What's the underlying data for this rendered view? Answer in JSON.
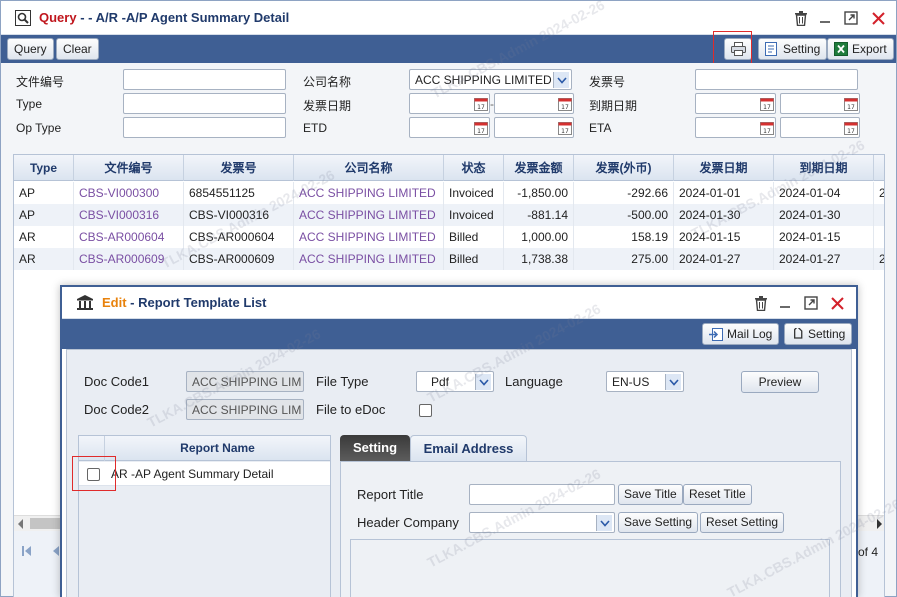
{
  "window": {
    "title_prefix": "Query",
    "title_rest": " - - A/R -A/P Agent Summary Detail"
  },
  "toolbar": {
    "query_label": "Query",
    "clear_label": "Clear",
    "setting_label": "Setting",
    "export_label": "Export"
  },
  "form": {
    "doc_no_label": "文件编号",
    "type_label": "Type",
    "op_type_label": "Op Type",
    "company_label": "公司名称",
    "company_value": "ACC SHIPPING LIMITED",
    "invoice_date_label": "发票日期",
    "etd_label": "ETD",
    "invoice_no_label": "发票号",
    "due_date_label": "到期日期",
    "eta_label": "ETA"
  },
  "grid": {
    "headers": [
      "Type",
      "文件编号",
      "发票号",
      "公司名称",
      "状态",
      "发票金额",
      "发票(外币)",
      "发票日期",
      "到期日期"
    ],
    "rows": [
      [
        "AP",
        "CBS-VI000300",
        "6854551125",
        "ACC SHIPPING LIMITED",
        "Invoiced",
        "-1,850.00",
        "-292.66",
        "2024-01-01",
        "2024-01-04"
      ],
      [
        "AP",
        "CBS-VI000316",
        "CBS-VI000316",
        "ACC SHIPPING LIMITED",
        "Invoiced",
        "-881.14",
        "-500.00",
        "2024-01-30",
        "2024-01-30"
      ],
      [
        "AR",
        "CBS-AR000604",
        "CBS-AR000604",
        "ACC SHIPPING LIMITED",
        "Billed",
        "1,000.00",
        "158.19",
        "2024-01-15",
        "2024-01-15"
      ],
      [
        "AR",
        "CBS-AR000609",
        "CBS-AR000609",
        "ACC SHIPPING LIMITED",
        "Billed",
        "1,738.38",
        "275.00",
        "2024-01-27",
        "2024-01-27"
      ]
    ],
    "overflow_col": [
      "2",
      "",
      "",
      "2"
    ],
    "pager_text": "of 4"
  },
  "dialog": {
    "title_prefix": "Edit",
    "title_rest": " - Report Template List",
    "mail_log_label": "Mail Log",
    "setting_label": "Setting",
    "doc_code1_label": "Doc Code1",
    "doc_code1_value": "ACC SHIPPING LIM",
    "doc_code2_label": "Doc Code2",
    "doc_code2_value": "ACC SHIPPING LIM",
    "file_type_label": "File Type",
    "file_type_value": "Pdf",
    "file_to_edoc_label": "File to eDoc",
    "language_label": "Language",
    "language_value": "EN-US",
    "preview_label": "Preview",
    "report_name_header": "Report Name",
    "report_name_item": "AR -AP Agent Summary Detail",
    "tab_setting": "Setting",
    "tab_email": "Email Address",
    "report_title_label": "Report Title",
    "header_company_label": "Header Company",
    "save_title_label": "Save Title",
    "reset_title_label": "Reset Title",
    "save_setting_label": "Save Setting",
    "reset_setting_label": "Reset Setting"
  },
  "watermark": {
    "text": "TLKA.CBS.Admin 2024-02-26"
  },
  "colors": {
    "toolbar_blue": "#3f5f94",
    "title_red": "#c0161d",
    "dialog_edit_orange": "#e8820c",
    "link_purple": "#7a4fa3"
  }
}
